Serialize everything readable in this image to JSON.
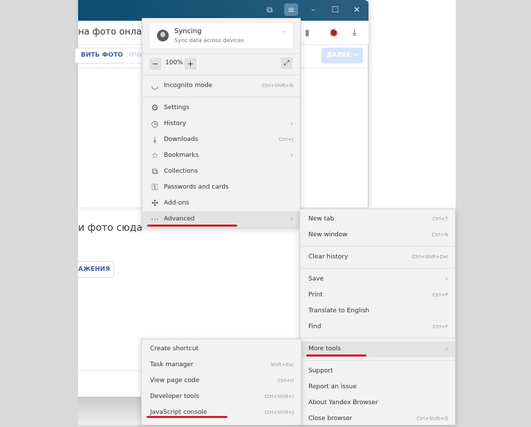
{
  "page": {
    "address_text": "на фото онлайн и",
    "toolbar_buttons": [
      "ВИТЬ ФОТО",
      "ОЧИ"
    ],
    "next_button": "ДАЛЕЕ →",
    "drop_text": "и фото сюда",
    "drop_button": "АЖЕНИЯ"
  },
  "titlebar": {
    "icons": [
      "collections-icon",
      "menu-icon",
      "minimize-icon",
      "maximize-icon",
      "close-icon"
    ],
    "glyphs": [
      "⧉",
      "≡",
      "–",
      "☐",
      "✕"
    ]
  },
  "address_icons": {
    "bookmark": "▮",
    "extension": "🐞",
    "download": "⤓"
  },
  "main_menu": {
    "sync": {
      "title": "Syncing",
      "subtitle": "Sync data across devices",
      "chevron": "⌄"
    },
    "zoom": {
      "minus": "−",
      "value": "100%",
      "plus": "+",
      "fullscreen": "⤢"
    },
    "incognito": {
      "label": "Incognito mode",
      "shortcut": "Ctrl+Shift+N",
      "icon": "◡"
    },
    "items": [
      {
        "label": "Settings",
        "shortcut": "",
        "submenu": false,
        "icon": "⚙"
      },
      {
        "label": "History",
        "shortcut": "",
        "submenu": true,
        "icon": "◷"
      },
      {
        "label": "Downloads",
        "shortcut": "Ctrl+J",
        "submenu": false,
        "icon": "⤓"
      },
      {
        "label": "Bookmarks",
        "shortcut": "",
        "submenu": true,
        "icon": "☆"
      },
      {
        "label": "Collections",
        "shortcut": "",
        "submenu": false,
        "icon": "⧉"
      },
      {
        "label": "Passwords and cards",
        "shortcut": "",
        "submenu": false,
        "icon": "⚿"
      },
      {
        "label": "Add-ons",
        "shortcut": "",
        "submenu": false,
        "icon": "✣"
      },
      {
        "label": "Advanced",
        "shortcut": "",
        "submenu": true,
        "icon": "⋯",
        "highlighted": true
      }
    ]
  },
  "advanced_menu": {
    "groups": [
      [
        {
          "label": "New tab",
          "shortcut": "Ctrl+T"
        },
        {
          "label": "New window",
          "shortcut": "Ctrl+N"
        }
      ],
      [
        {
          "label": "Clear history",
          "shortcut": "Ctrl+Shift+Del"
        }
      ],
      [
        {
          "label": "Save",
          "shortcut": "",
          "submenu": true
        },
        {
          "label": "Print",
          "shortcut": "Ctrl+P"
        },
        {
          "label": "Translate to English",
          "shortcut": ""
        },
        {
          "label": "Find",
          "shortcut": "Ctrl+F"
        }
      ],
      [
        {
          "label": "More tools",
          "shortcut": "",
          "submenu": true,
          "highlighted": true
        }
      ],
      [
        {
          "label": "Support",
          "shortcut": ""
        },
        {
          "label": "Report an issue",
          "shortcut": ""
        },
        {
          "label": "About Yandex Browser",
          "shortcut": ""
        },
        {
          "label": "Close browser",
          "shortcut": "Ctrl+Shift+Q"
        }
      ]
    ]
  },
  "more_tools_menu": {
    "items": [
      {
        "label": "Create shortcut",
        "shortcut": ""
      },
      {
        "label": "Task manager",
        "shortcut": "Shift+Esc"
      },
      {
        "label": "View page code",
        "shortcut": "Ctrl+U"
      },
      {
        "label": "Developer tools",
        "shortcut": "Ctrl+Shift+I"
      },
      {
        "label": "JavaScript console",
        "shortcut": "Ctrl+Shift+J"
      }
    ]
  },
  "chevron_glyph": "›",
  "colors": {
    "titlebar": "#0d4d70",
    "annotation_red": "#d21f2b",
    "menu_bg": "#f2f2f2",
    "highlight": "#e3e3e3",
    "link_blue": "#3a5fa8"
  }
}
